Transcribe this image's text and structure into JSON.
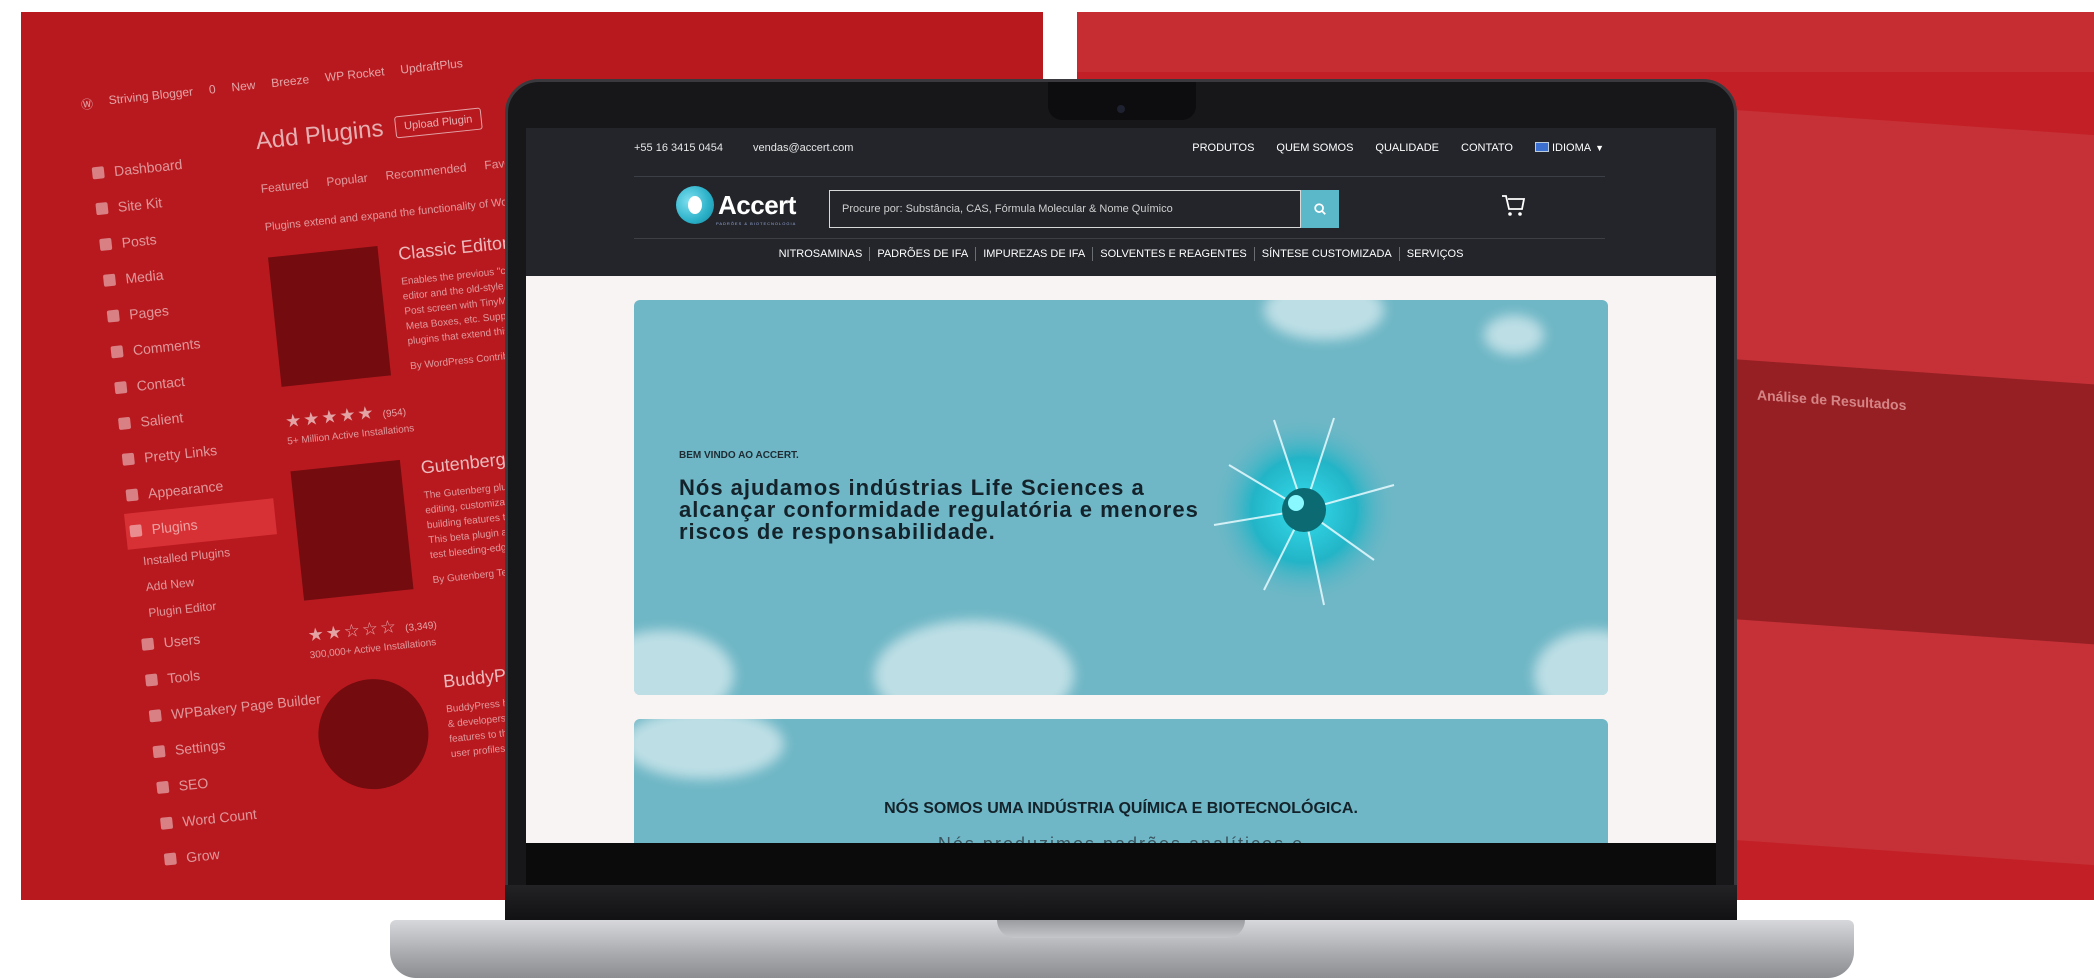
{
  "background": {
    "left_panel_color": "#b8191f",
    "right_panel_color": "#c22026",
    "wp_admin": {
      "toolbar": [
        "Striving Blogger",
        "0",
        "New",
        "Breeze",
        "WP Rocket",
        "UpdraftPlus"
      ],
      "menu": [
        {
          "label": "Dashboard"
        },
        {
          "label": "Site Kit"
        },
        {
          "label": "Posts"
        },
        {
          "label": "Media"
        },
        {
          "label": "Pages"
        },
        {
          "label": "Comments"
        },
        {
          "label": "Contact"
        },
        {
          "label": "Salient"
        },
        {
          "label": "Pretty Links"
        },
        {
          "label": "Appearance"
        },
        {
          "label": "Plugins"
        },
        {
          "label": "Installed Plugins"
        },
        {
          "label": "Add New"
        },
        {
          "label": "Plugin Editor"
        },
        {
          "label": "Users"
        },
        {
          "label": "Tools"
        },
        {
          "label": "WPBakery Page Builder"
        },
        {
          "label": "Settings"
        },
        {
          "label": "SEO"
        },
        {
          "label": "Word Count"
        },
        {
          "label": "Grow"
        }
      ],
      "title": "Add Plugins",
      "upload_button": "Upload Plugin",
      "tabs": [
        "Featured",
        "Popular",
        "Recommended",
        "Favorites"
      ],
      "description": "Plugins extend and expand the functionality of WordPress.",
      "plugins": [
        {
          "name": "Classic Editor",
          "desc": "Enables the previous \"classic\" editor and the old-style Edit Post screen with TinyMCE, Meta Boxes, etc. Supports all plugins that extend this screen.",
          "author": "By WordPress Contributors",
          "rating_count": "(954)",
          "installs": "5+ Million Active Installations"
        },
        {
          "name": "Gutenberg",
          "desc": "The Gutenberg plugin provides editing, customization, and site building features to WordPress. This beta plugin allows you to test bleeding-edge featu...",
          "author": "By Gutenberg Team",
          "rating_count": "(3,349)",
          "installs": "300,000+ Active Installations"
        },
        {
          "name": "BuddyPress",
          "desc": "BuddyPress helps site builders & developers add community features to their websites, with user profiles...",
          "author": "",
          "rating_count": "",
          "installs": ""
        }
      ]
    },
    "right_title": "Análise de Resultados"
  },
  "site": {
    "contact": {
      "phone": "+55 16 3415 0454",
      "email": "vendas@accert.com"
    },
    "topnav": [
      "PRODUTOS",
      "QUEM SOMOS",
      "QUALIDADE",
      "CONTATO"
    ],
    "language": "IDIOMA",
    "logo": {
      "name": "Accert",
      "tagline": "PADRÕES & BIOTECNOLOGIA"
    },
    "search": {
      "placeholder": "Procure por: Substância, CAS, Fórmula Molecular & Nome Químico"
    },
    "categories": [
      "NITROSAMINAS",
      "PADRÕES DE IFA",
      "IMPUREZAS DE IFA",
      "SOLVENTES E REAGENTES",
      "SÍNTESE CUSTOMIZADA",
      "SERVIÇOS"
    ],
    "hero": {
      "kicker": "BEM VINDO AO ACCERT.",
      "title": "Nós ajudamos indústrias Life Sciences a alcançar conformidade regulatória e menores riscos de responsabilidade."
    },
    "section2": {
      "title": "NÓS SOMOS UMA INDÚSTRIA QUÍMICA E BIOTECNOLÓGICA.",
      "subtitle": "Nós produzimos padrões analíticos e"
    },
    "colors": {
      "dark": "#23252a",
      "accent": "#5bb8c9",
      "hero": "#6fb7c6"
    }
  }
}
